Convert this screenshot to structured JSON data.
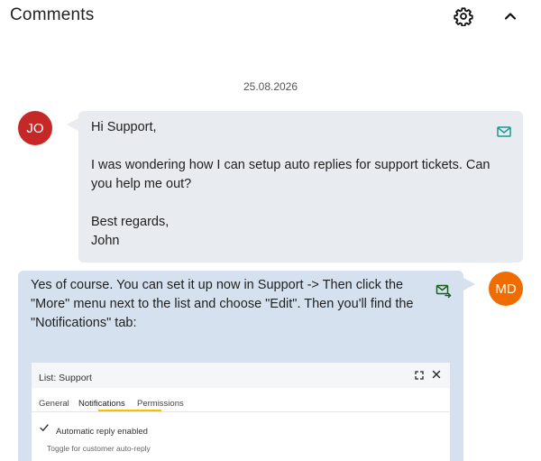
{
  "header": {
    "title": "Comments",
    "settings_icon": "gear-icon",
    "collapse_icon": "chevron-up-icon"
  },
  "date_separator": "25.08.2026",
  "messages": [
    {
      "avatar_initials": "JO",
      "avatar_color": "#c62828",
      "bubble_color": "#e8ebf0",
      "channel_icon": "mail-icon",
      "paragraphs": [
        "Hi Support,",
        "I was wondering how I can setup auto replies for support tickets. Can you help me out?",
        "Best regards,\nJohn"
      ]
    },
    {
      "avatar_initials": "MD",
      "avatar_color": "#ef6c00",
      "bubble_color": "#d5e1ee",
      "channel_icon": "mail-sent-icon",
      "text": "Yes of course. You can set it up now in Support -> Then click the \"More\" menu next to the list and choose \"Edit\". Then you'll find the \"Notifications\" tab:",
      "embedded_screenshot": {
        "title": "List: Support",
        "tabs": [
          "General",
          "Notifications",
          "Permissions"
        ],
        "active_tab": "Notifications",
        "checkbox_label": "Automatic reply enabled",
        "checkbox_checked": true,
        "hint": "Toggle for customer auto-reply",
        "accent_color": "#f2c200"
      }
    }
  ]
}
